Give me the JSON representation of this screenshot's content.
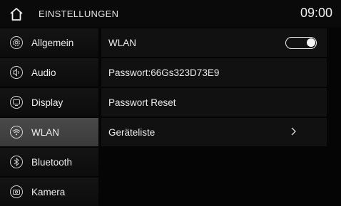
{
  "header": {
    "title": "EINSTELLUNGEN",
    "time": "09:00",
    "home_icon": "home-icon"
  },
  "sidebar": {
    "items": [
      {
        "label": "Allgemein",
        "icon": "gear-icon",
        "active": false
      },
      {
        "label": "Audio",
        "icon": "speaker-icon",
        "active": false
      },
      {
        "label": "Display",
        "icon": "display-icon",
        "active": false
      },
      {
        "label": "WLAN",
        "icon": "wifi-icon",
        "active": true
      },
      {
        "label": "Bluetooth",
        "icon": "bluetooth-icon",
        "active": false
      },
      {
        "label": "Kamera",
        "icon": "camera-icon",
        "active": false
      }
    ]
  },
  "wlan": {
    "toggle_label": "WLAN",
    "toggle_on": true,
    "password_label": "Passwort:66Gs323D73E9",
    "reset_label": "Passwort Reset",
    "devices_label": "Geräteliste"
  },
  "colors": {
    "background": "#050505",
    "row": "#111111",
    "active_item": "#444444",
    "text": "#ececec"
  }
}
